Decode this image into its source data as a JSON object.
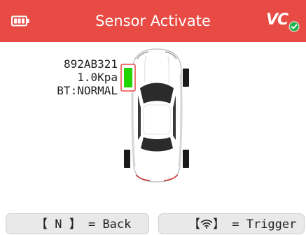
{
  "header": {
    "title": "Sensor Activate",
    "logo_text": "VC",
    "battery_icon": "battery-icon",
    "logo_badge_icon": "check-circle-icon"
  },
  "sensor": {
    "id": "892AB321",
    "pressure": "1.0Kpa",
    "battery_status": "BT:NORMAL",
    "highlighted_tire": "front-left"
  },
  "footer": {
    "back": {
      "key": "【 N 】",
      "label": "= Back"
    },
    "trigger": {
      "key_open": "【 ",
      "icon": "wifi-icon",
      "key_close": " 】",
      "label": "= Trigger"
    }
  },
  "colors": {
    "header_bg": "#e84a44",
    "header_text": "#ffffff",
    "sensor_active": "#22d400",
    "sensor_outline": "#e84a44",
    "tire": "#1a1a1a",
    "button_bg": "#e9e9e9"
  }
}
